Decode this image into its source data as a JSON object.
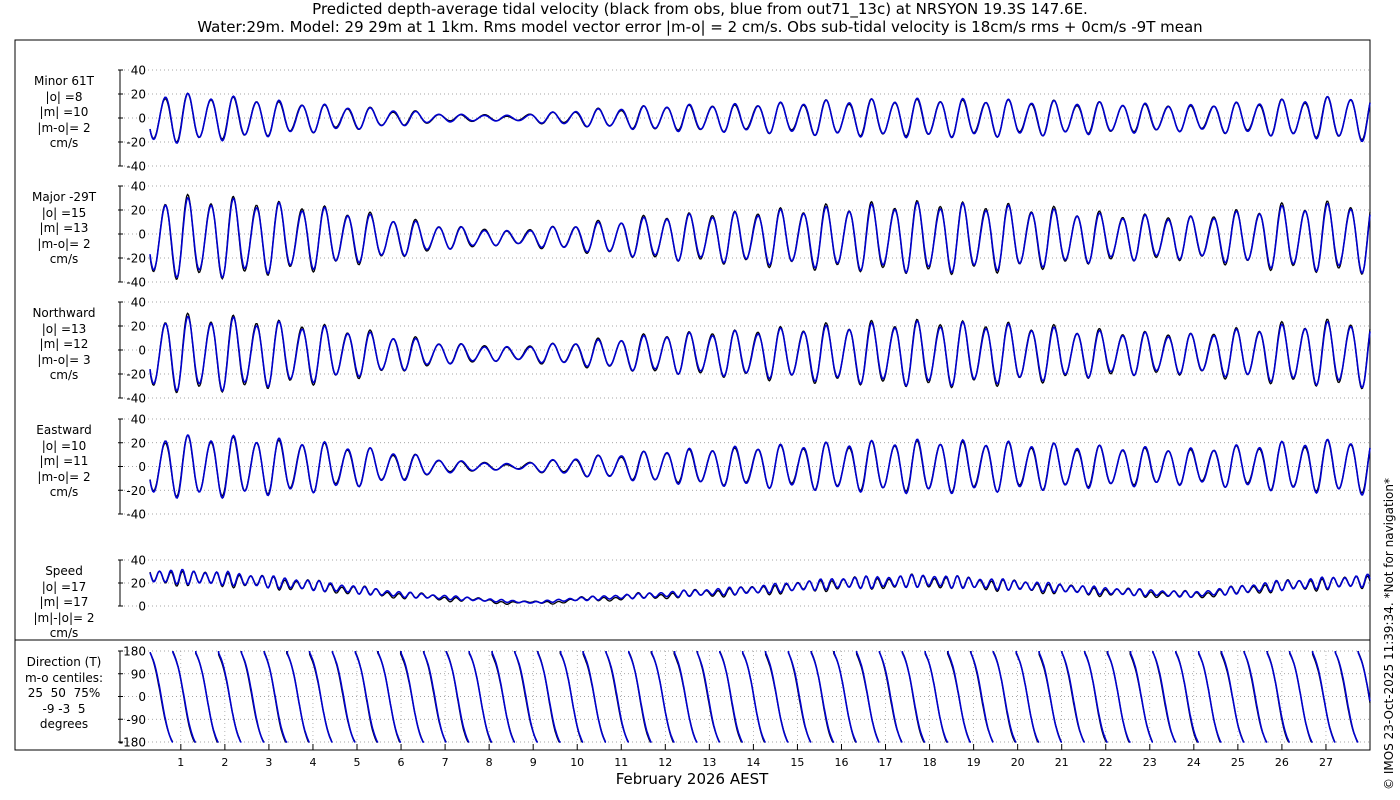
{
  "title_line1": "Predicted depth-average tidal velocity (black from obs, blue from out71_13c) at NRSYON 19.3S 147.6E.",
  "title_line2": "Water:29m. Model: 29 29m at 1 1km. Rms model vector error |m-o| = 2 cm/s. Obs sub-tidal velocity is 18cm/s rms + 0cm/s -9T mean",
  "xlabel": "February 2026 AEST",
  "credit": "© IMOS 23-Oct-2025 11:39:34. *Not for navigation*",
  "colors": {
    "obs": "#000000",
    "model": "#0000cc",
    "grid": "#888888"
  },
  "chart_data": {
    "type": "line",
    "x_unit": "day of February 2026 (AEST)",
    "xlim": [
      0.3,
      28.0
    ],
    "x_ticks": [
      1,
      2,
      3,
      4,
      5,
      6,
      7,
      8,
      9,
      10,
      11,
      12,
      13,
      14,
      15,
      16,
      17,
      18,
      19,
      20,
      21,
      22,
      23,
      24,
      25,
      26,
      27
    ],
    "series_legend": {
      "obs": "black from obs",
      "model": "blue from out71_13c"
    },
    "panels": [
      {
        "key": "minor",
        "label_lines": [
          "Minor 61T",
          "|o| =8",
          "|m| =10",
          "|m-o|= 2",
          "cm/s"
        ],
        "ylim": [
          -40,
          40
        ],
        "yticks": [
          -40,
          -20,
          0,
          20,
          40
        ],
        "env_points": [
          [
            0.3,
            20
          ],
          [
            2,
            17
          ],
          [
            4,
            11
          ],
          [
            6,
            6
          ],
          [
            7,
            3
          ],
          [
            8.5,
            2
          ],
          [
            10,
            6
          ],
          [
            12,
            10
          ],
          [
            14,
            11
          ],
          [
            16,
            14
          ],
          [
            18,
            15
          ],
          [
            20,
            14
          ],
          [
            22,
            12
          ],
          [
            24,
            10
          ],
          [
            26,
            14
          ],
          [
            28,
            18
          ]
        ],
        "mean": 0,
        "obs_scale": 0.97
      },
      {
        "key": "major",
        "label_lines": [
          "Major -29T",
          "|o| =15",
          "|m| =13",
          "|m-o|= 2",
          "cm/s"
        ],
        "ylim": [
          -40,
          40
        ],
        "yticks": [
          -40,
          -20,
          0,
          20,
          40
        ],
        "env_points": [
          [
            0.3,
            30
          ],
          [
            2,
            30
          ],
          [
            4,
            24
          ],
          [
            6,
            14
          ],
          [
            7,
            9
          ],
          [
            8.5,
            5
          ],
          [
            10,
            10
          ],
          [
            12,
            17
          ],
          [
            14,
            20
          ],
          [
            16,
            24
          ],
          [
            18,
            27
          ],
          [
            20,
            24
          ],
          [
            22,
            18
          ],
          [
            24,
            16
          ],
          [
            26,
            24
          ],
          [
            28,
            27
          ]
        ],
        "mean": -3,
        "obs_scale": 1.06
      },
      {
        "key": "north",
        "label_lines": [
          "Northward",
          "|o| =13",
          "|m| =12",
          "|m-o|= 3",
          "cm/s"
        ],
        "ylim": [
          -40,
          40
        ],
        "yticks": [
          -40,
          -20,
          0,
          20,
          40
        ],
        "env_points": [
          [
            0.3,
            28
          ],
          [
            2,
            28
          ],
          [
            4,
            22
          ],
          [
            6,
            13
          ],
          [
            7,
            8
          ],
          [
            8.5,
            5
          ],
          [
            10,
            9
          ],
          [
            12,
            15
          ],
          [
            14,
            18
          ],
          [
            16,
            22
          ],
          [
            18,
            25
          ],
          [
            20,
            22
          ],
          [
            22,
            17
          ],
          [
            24,
            15
          ],
          [
            26,
            22
          ],
          [
            28,
            26
          ]
        ],
        "mean": -3,
        "obs_scale": 1.06
      },
      {
        "key": "east",
        "label_lines": [
          "Eastward",
          "|o| =10",
          "|m| =11",
          "|m-o|= 2",
          "cm/s"
        ],
        "ylim": [
          -40,
          40
        ],
        "yticks": [
          -40,
          -20,
          0,
          20,
          40
        ],
        "env_points": [
          [
            0.3,
            24
          ],
          [
            2,
            24
          ],
          [
            4,
            20
          ],
          [
            6,
            11
          ],
          [
            7,
            5
          ],
          [
            8.5,
            2
          ],
          [
            10,
            7
          ],
          [
            12,
            13
          ],
          [
            14,
            16
          ],
          [
            16,
            19
          ],
          [
            18,
            21
          ],
          [
            20,
            19
          ],
          [
            22,
            16
          ],
          [
            24,
            14
          ],
          [
            26,
            19
          ],
          [
            28,
            22
          ]
        ],
        "mean": 0,
        "obs_scale": 0.96
      },
      {
        "key": "speed",
        "label_lines": [
          "Speed",
          "|o| =17",
          "|m| =17",
          "|m|-|o|= 2",
          "cm/s"
        ],
        "ylim": [
          0,
          40
        ],
        "yticks": [
          0,
          20,
          40
        ],
        "speed_base": [
          [
            0.3,
            26
          ],
          [
            2,
            24
          ],
          [
            4,
            18
          ],
          [
            6,
            10
          ],
          [
            8,
            5
          ],
          [
            9,
            3
          ],
          [
            10,
            6
          ],
          [
            12,
            10
          ],
          [
            14,
            14
          ],
          [
            16,
            20
          ],
          [
            18,
            22
          ],
          [
            20,
            18
          ],
          [
            22,
            13
          ],
          [
            24,
            10
          ],
          [
            26,
            18
          ],
          [
            28,
            22
          ]
        ]
      },
      {
        "key": "direction",
        "label_lines": [
          "Direction (T)",
          "m-o centiles:",
          "25  50  75%",
          "-9 -3  5",
          "degrees"
        ],
        "ylim": [
          -180,
          180
        ],
        "yticks": [
          -180,
          -90,
          0,
          90,
          180
        ]
      }
    ],
    "direction_centiles": {
      "percentiles": [
        25,
        50,
        75
      ],
      "m_minus_o_deg": [
        -9,
        -3,
        5
      ]
    }
  }
}
